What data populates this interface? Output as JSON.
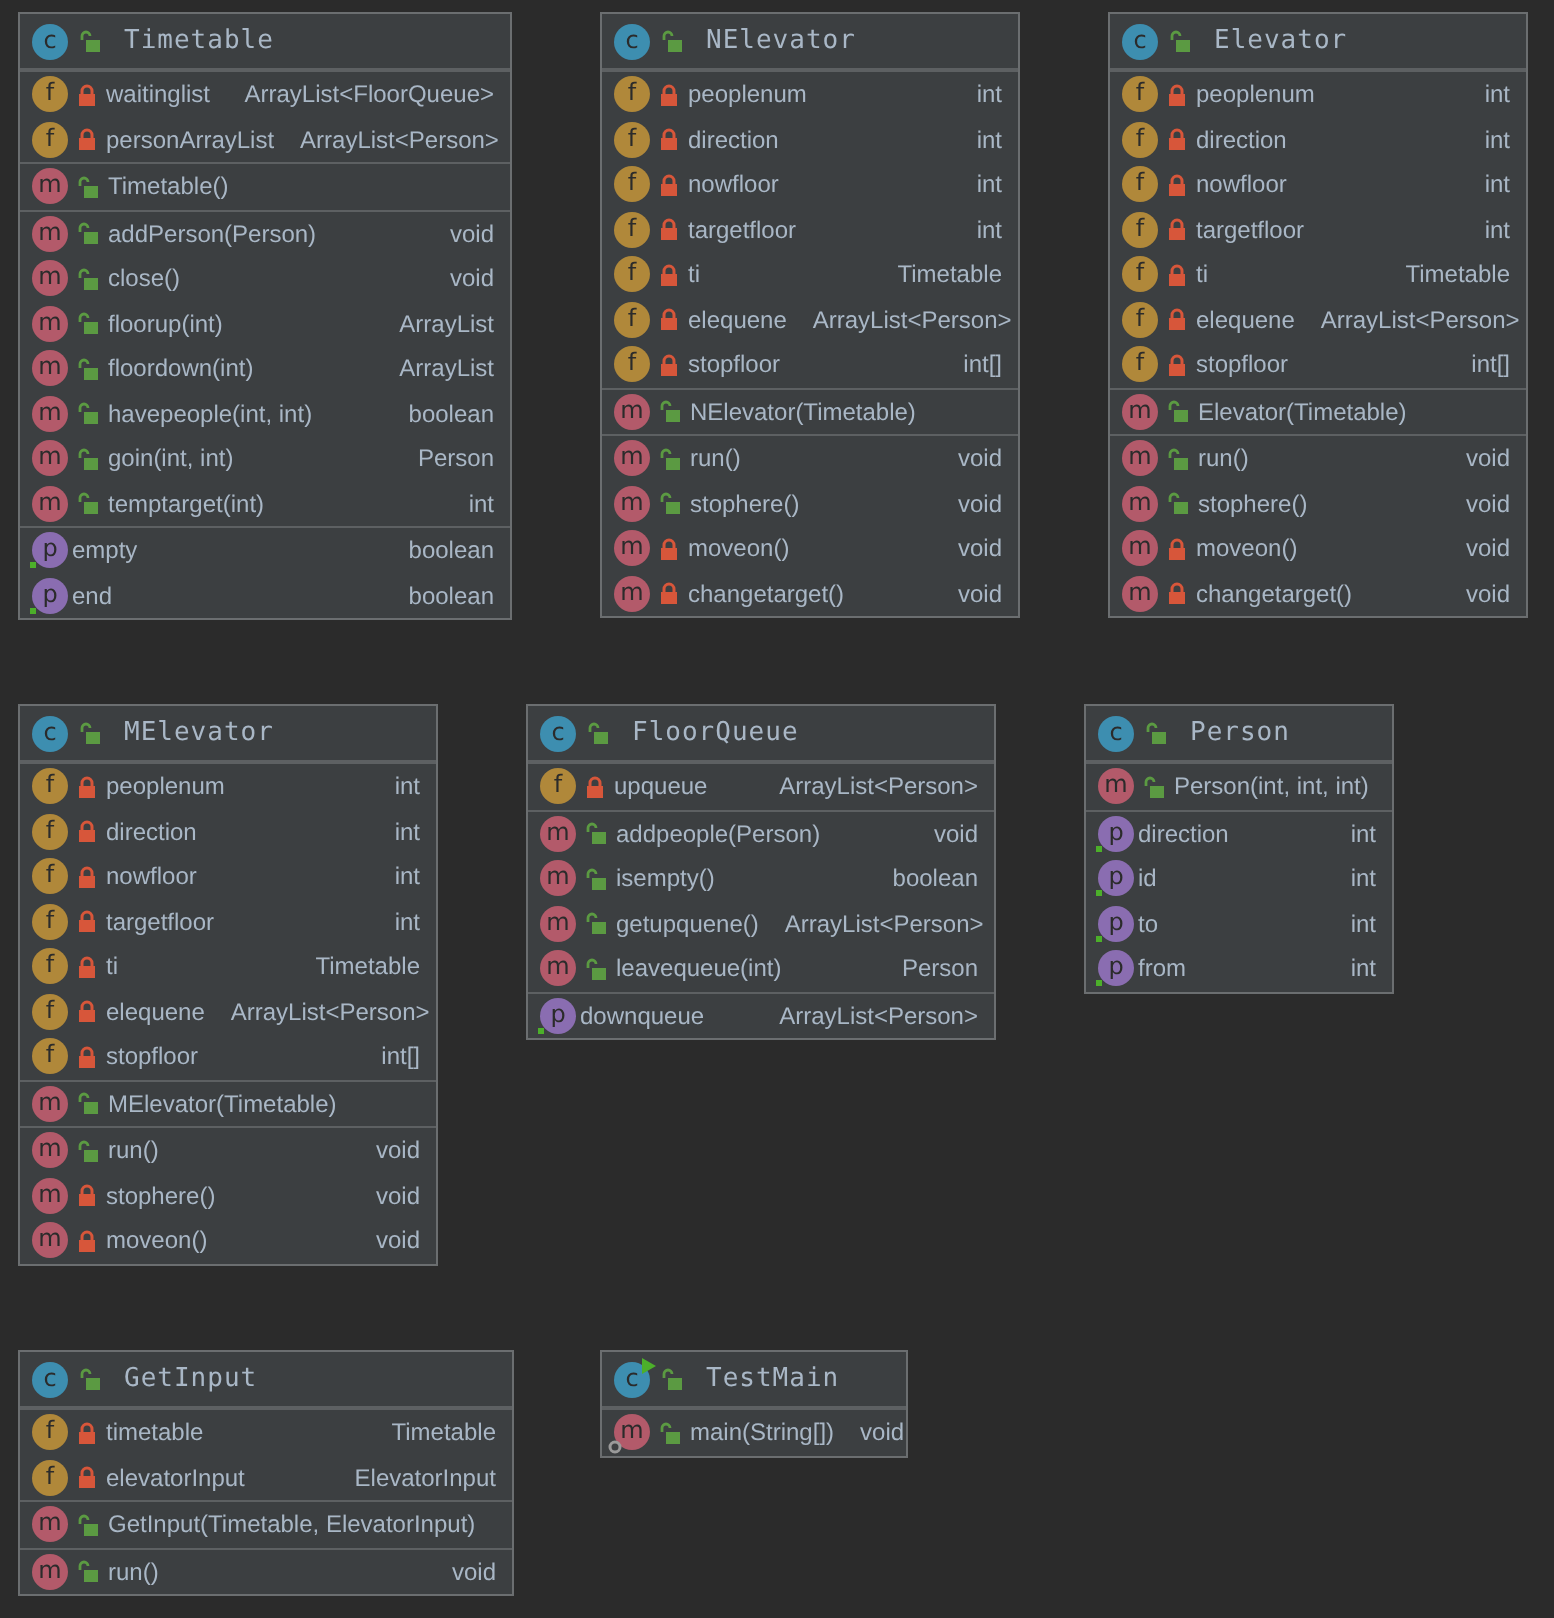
{
  "classes": [
    {
      "name": "Timetable",
      "badge": "c",
      "runnable": false,
      "sections": [
        [
          {
            "kind": "field",
            "badge": "f",
            "private": true,
            "name": "waitinglist",
            "type": "ArrayList<FloorQueue>"
          },
          {
            "kind": "field",
            "badge": "f",
            "private": true,
            "name": "personArrayList",
            "type": "ArrayList<Person>"
          }
        ],
        [
          {
            "kind": "method",
            "badge": "m",
            "private": false,
            "name": "Timetable()"
          }
        ],
        [
          {
            "kind": "method",
            "badge": "m",
            "private": false,
            "name": "addPerson(Person)",
            "type": "void"
          },
          {
            "kind": "method",
            "badge": "m",
            "private": false,
            "name": "close()",
            "type": "void"
          },
          {
            "kind": "method",
            "badge": "m",
            "private": false,
            "name": "floorup(int)",
            "type": "ArrayList"
          },
          {
            "kind": "method",
            "badge": "m",
            "private": false,
            "name": "floordown(int)",
            "type": "ArrayList"
          },
          {
            "kind": "method",
            "badge": "m",
            "private": false,
            "name": "havepeople(int, int)",
            "type": "boolean"
          },
          {
            "kind": "method",
            "badge": "m",
            "private": false,
            "name": "goin(int, int)",
            "type": "Person"
          },
          {
            "kind": "method",
            "badge": "m",
            "private": false,
            "name": "temptarget(int)",
            "type": "int"
          }
        ],
        [
          {
            "kind": "property",
            "badge": "p",
            "name": "empty",
            "type": "boolean"
          },
          {
            "kind": "property",
            "badge": "p",
            "name": "end",
            "type": "boolean"
          }
        ]
      ]
    },
    {
      "name": "NElevator",
      "badge": "c",
      "runnable": false,
      "sections": [
        [
          {
            "kind": "field",
            "badge": "f",
            "private": true,
            "name": "peoplenum",
            "type": "int"
          },
          {
            "kind": "field",
            "badge": "f",
            "private": true,
            "name": "direction",
            "type": "int"
          },
          {
            "kind": "field",
            "badge": "f",
            "private": true,
            "name": "nowfloor",
            "type": "int"
          },
          {
            "kind": "field",
            "badge": "f",
            "private": true,
            "name": "targetfloor",
            "type": "int"
          },
          {
            "kind": "field",
            "badge": "f",
            "private": true,
            "name": "ti",
            "type": "Timetable"
          },
          {
            "kind": "field",
            "badge": "f",
            "private": true,
            "name": "elequene",
            "type": "ArrayList<Person>"
          },
          {
            "kind": "field",
            "badge": "f",
            "private": true,
            "name": "stopfloor",
            "type": "int[]"
          }
        ],
        [
          {
            "kind": "method",
            "badge": "m",
            "private": false,
            "name": "NElevator(Timetable)"
          }
        ],
        [
          {
            "kind": "method",
            "badge": "m",
            "private": false,
            "name": "run()",
            "type": "void"
          },
          {
            "kind": "method",
            "badge": "m",
            "private": false,
            "name": "stophere()",
            "type": "void"
          },
          {
            "kind": "method",
            "badge": "m",
            "private": true,
            "name": "moveon()",
            "type": "void"
          },
          {
            "kind": "method",
            "badge": "m",
            "private": true,
            "name": "changetarget()",
            "type": "void"
          }
        ]
      ]
    },
    {
      "name": "Elevator",
      "badge": "c",
      "runnable": false,
      "sections": [
        [
          {
            "kind": "field",
            "badge": "f",
            "private": true,
            "name": "peoplenum",
            "type": "int"
          },
          {
            "kind": "field",
            "badge": "f",
            "private": true,
            "name": "direction",
            "type": "int"
          },
          {
            "kind": "field",
            "badge": "f",
            "private": true,
            "name": "nowfloor",
            "type": "int"
          },
          {
            "kind": "field",
            "badge": "f",
            "private": true,
            "name": "targetfloor",
            "type": "int"
          },
          {
            "kind": "field",
            "badge": "f",
            "private": true,
            "name": "ti",
            "type": "Timetable"
          },
          {
            "kind": "field",
            "badge": "f",
            "private": true,
            "name": "elequene",
            "type": "ArrayList<Person>"
          },
          {
            "kind": "field",
            "badge": "f",
            "private": true,
            "name": "stopfloor",
            "type": "int[]"
          }
        ],
        [
          {
            "kind": "method",
            "badge": "m",
            "private": false,
            "name": "Elevator(Timetable)"
          }
        ],
        [
          {
            "kind": "method",
            "badge": "m",
            "private": false,
            "name": "run()",
            "type": "void"
          },
          {
            "kind": "method",
            "badge": "m",
            "private": false,
            "name": "stophere()",
            "type": "void"
          },
          {
            "kind": "method",
            "badge": "m",
            "private": true,
            "name": "moveon()",
            "type": "void"
          },
          {
            "kind": "method",
            "badge": "m",
            "private": true,
            "name": "changetarget()",
            "type": "void"
          }
        ]
      ]
    },
    {
      "name": "MElevator",
      "badge": "c",
      "runnable": false,
      "sections": [
        [
          {
            "kind": "field",
            "badge": "f",
            "private": true,
            "name": "peoplenum",
            "type": "int"
          },
          {
            "kind": "field",
            "badge": "f",
            "private": true,
            "name": "direction",
            "type": "int"
          },
          {
            "kind": "field",
            "badge": "f",
            "private": true,
            "name": "nowfloor",
            "type": "int"
          },
          {
            "kind": "field",
            "badge": "f",
            "private": true,
            "name": "targetfloor",
            "type": "int"
          },
          {
            "kind": "field",
            "badge": "f",
            "private": true,
            "name": "ti",
            "type": "Timetable"
          },
          {
            "kind": "field",
            "badge": "f",
            "private": true,
            "name": "elequene",
            "type": "ArrayList<Person>"
          },
          {
            "kind": "field",
            "badge": "f",
            "private": true,
            "name": "stopfloor",
            "type": "int[]"
          }
        ],
        [
          {
            "kind": "method",
            "badge": "m",
            "private": false,
            "name": "MElevator(Timetable)"
          }
        ],
        [
          {
            "kind": "method",
            "badge": "m",
            "private": false,
            "name": "run()",
            "type": "void"
          },
          {
            "kind": "method",
            "badge": "m",
            "private": true,
            "name": "stophere()",
            "type": "void"
          },
          {
            "kind": "method",
            "badge": "m",
            "private": true,
            "name": "moveon()",
            "type": "void"
          }
        ]
      ]
    },
    {
      "name": "FloorQueue",
      "badge": "c",
      "runnable": false,
      "sections": [
        [
          {
            "kind": "field",
            "badge": "f",
            "private": true,
            "name": "upqueue",
            "type": "ArrayList<Person>"
          }
        ],
        [
          {
            "kind": "method",
            "badge": "m",
            "private": false,
            "name": "addpeople(Person)",
            "type": "void"
          },
          {
            "kind": "method",
            "badge": "m",
            "private": false,
            "name": "isempty()",
            "type": "boolean"
          },
          {
            "kind": "method",
            "badge": "m",
            "private": false,
            "name": "getupquene()",
            "type": "ArrayList<Person>"
          },
          {
            "kind": "method",
            "badge": "m",
            "private": false,
            "name": "leavequeue(int)",
            "type": "Person"
          }
        ],
        [
          {
            "kind": "property",
            "badge": "p",
            "name": "downqueue",
            "type": "ArrayList<Person>"
          }
        ]
      ]
    },
    {
      "name": "Person",
      "badge": "c",
      "runnable": false,
      "sections": [
        [
          {
            "kind": "method",
            "badge": "m",
            "private": false,
            "name": "Person(int, int, int)"
          }
        ],
        [
          {
            "kind": "property",
            "badge": "p",
            "name": "direction",
            "type": "int"
          },
          {
            "kind": "property",
            "badge": "p",
            "name": "id",
            "type": "int"
          },
          {
            "kind": "property",
            "badge": "p",
            "name": "to",
            "type": "int"
          },
          {
            "kind": "property",
            "badge": "p",
            "name": "from",
            "type": "int"
          }
        ]
      ]
    },
    {
      "name": "GetInput",
      "badge": "c",
      "runnable": false,
      "sections": [
        [
          {
            "kind": "field",
            "badge": "f",
            "private": true,
            "name": "timetable",
            "type": "Timetable"
          },
          {
            "kind": "field",
            "badge": "f",
            "private": true,
            "name": "elevatorInput",
            "type": "ElevatorInput"
          }
        ],
        [
          {
            "kind": "method",
            "badge": "m",
            "private": false,
            "name": "GetInput(Timetable, ElevatorInput)"
          }
        ],
        [
          {
            "kind": "method",
            "badge": "m",
            "private": false,
            "name": "run()",
            "type": "void"
          }
        ]
      ]
    },
    {
      "name": "TestMain",
      "badge": "c",
      "runnable": true,
      "sections": [
        [
          {
            "kind": "static-method",
            "badge": "m",
            "private": false,
            "name": "main(String[])",
            "type": "void"
          }
        ]
      ]
    }
  ]
}
